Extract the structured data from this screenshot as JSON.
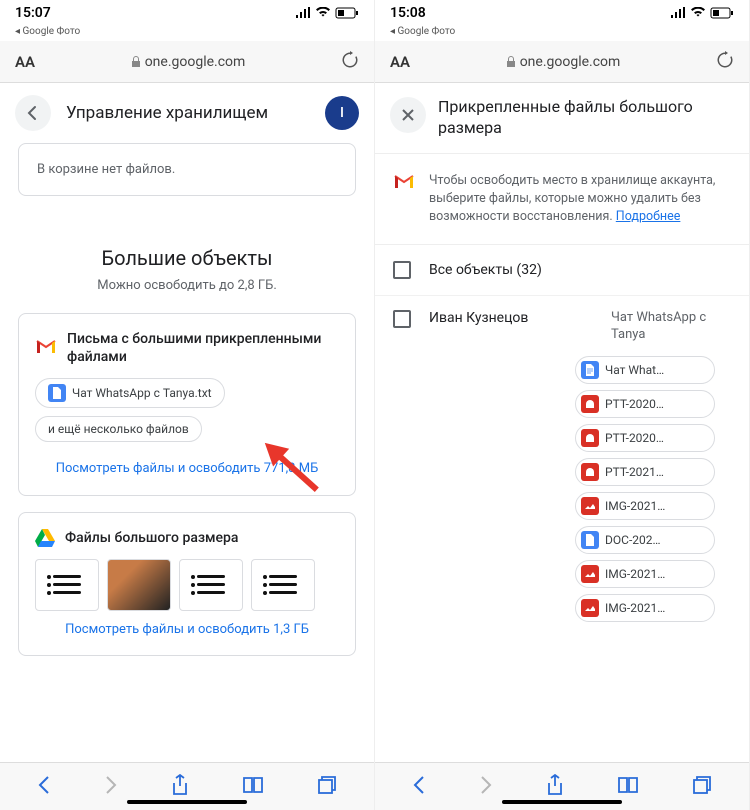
{
  "left": {
    "status": {
      "time": "15:07",
      "back_app": "◂ Google Фото"
    },
    "safari": {
      "aa": "AA",
      "url": "one.google.com"
    },
    "header": {
      "title": "Управление хранилищем",
      "avatar_letter": "I"
    },
    "trash_msg": "В корзине нет файлов.",
    "section": {
      "title": "Большие объекты",
      "subtitle": "Можно освободить до 2,8 ГБ."
    },
    "gmail_card": {
      "title": "Письма с большими прикрепленными файлами",
      "chip_file": "Чат WhatsApp с Tanya.txt",
      "chip_more": "и ещё несколько файлов",
      "link": "Посмотреть файлы и освободить 771,8 МБ"
    },
    "drive_card": {
      "title": "Файлы большого размера",
      "link": "Посмотреть файлы и освободить 1,3 ГБ"
    }
  },
  "right": {
    "status": {
      "time": "15:08",
      "back_app": "◂ Google Фото"
    },
    "safari": {
      "aa": "AA",
      "url": "one.google.com"
    },
    "header": {
      "title": "Прикрепленные файлы большого размера"
    },
    "info_text": "Чтобы освободить место в хранилище аккаунта, выберите файлы, которые можно удалить без возможности восстановления.",
    "info_link": "Подробнее",
    "all_label": "Все объекты (32)",
    "sender": "Иван Кузнецов",
    "chat_title": "Чат WhatsApp с Tanya",
    "files": [
      {
        "name": "Чат What…",
        "icon": "doc"
      },
      {
        "name": "PTT-2020…",
        "icon": "red"
      },
      {
        "name": "PTT-2020…",
        "icon": "red"
      },
      {
        "name": "PTT-2021…",
        "icon": "red"
      },
      {
        "name": "IMG-2021…",
        "icon": "img"
      },
      {
        "name": "DOC-202…",
        "icon": "blue"
      },
      {
        "name": "IMG-2021…",
        "icon": "img"
      },
      {
        "name": "IMG-2021…",
        "icon": "img"
      }
    ]
  },
  "colors": {
    "blue": "#1a73e8",
    "red": "#d93025",
    "grey": "#5f6368"
  }
}
